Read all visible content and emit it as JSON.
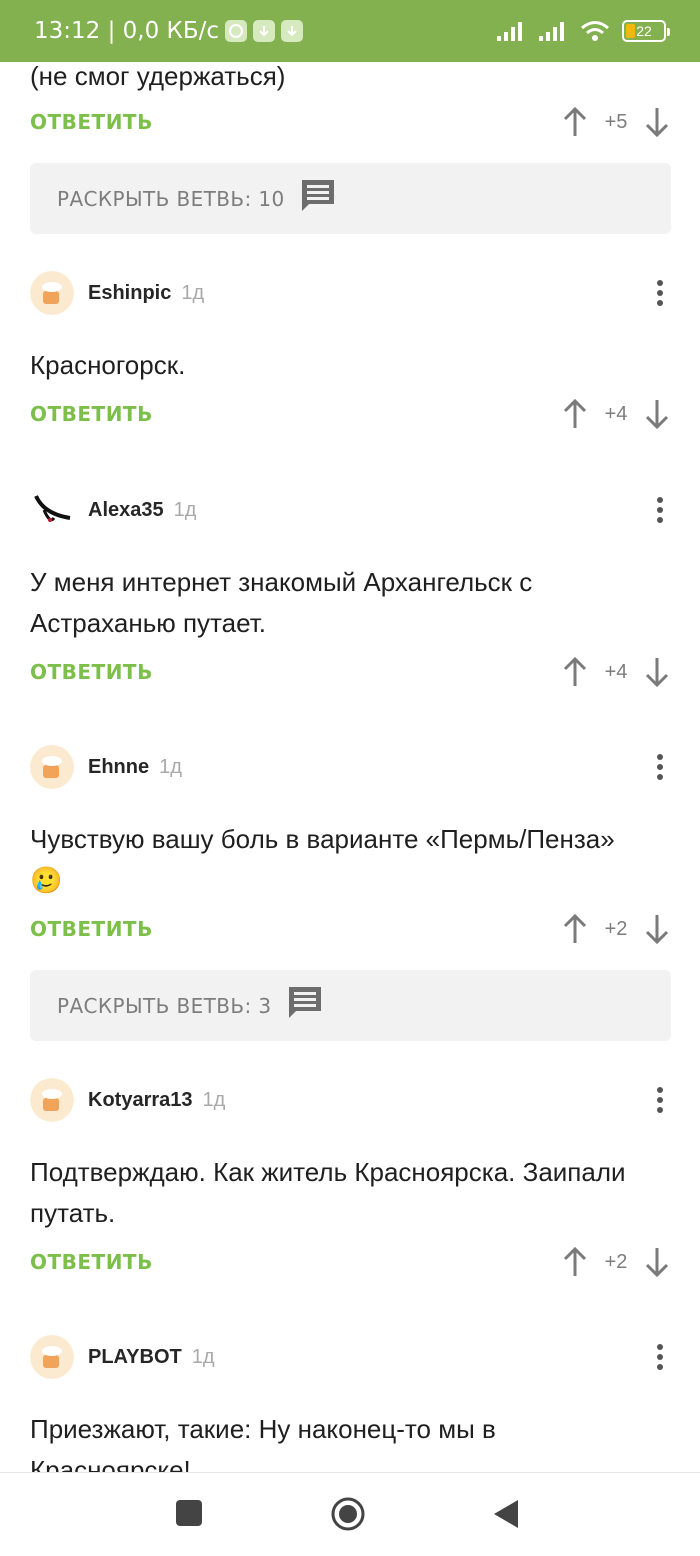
{
  "status_bar": {
    "time_speed": "13:12 | 0,0 КБ/с",
    "battery": "22",
    "accent_color": "#83b14f"
  },
  "top_partial": {
    "text": "(не смог удержаться)",
    "reply_label": "ОТВЕТИТЬ",
    "score": "+5"
  },
  "branches": [
    {
      "label": "РАСКРЫТЬ ВЕТВЬ: 10"
    },
    {
      "label": "РАСКРЫТЬ ВЕТВЬ: 3"
    }
  ],
  "comments": [
    {
      "author": "Eshinpic",
      "time": "1д",
      "text": "Красногорск.",
      "reply_label": "ОТВЕТИТЬ",
      "score": "+4"
    },
    {
      "author": "Alexa35",
      "time": "1д",
      "text": "У меня интернет знакомый Архангельск с Астраханью путает.",
      "reply_label": "ОТВЕТИТЬ",
      "score": "+4"
    },
    {
      "author": "Ehnne",
      "time": "1д",
      "text": "Чувствую вашу боль в варианте «Пермь/Пенза» 🥲",
      "reply_label": "ОТВЕТИТЬ",
      "score": "+2"
    },
    {
      "author": "Kotyarra13",
      "time": "1д",
      "text": "Подтверждаю. Как житель Красноярска. Заипали путать.",
      "reply_label": "ОТВЕТИТЬ",
      "score": "+2"
    },
    {
      "author": "PLAYBOT",
      "time": "1д",
      "text": "Приезжают, такие: Ну наконец-то мы в Красноярске!"
    }
  ],
  "icons": {
    "upvote": "arrow-up-icon",
    "downvote": "arrow-down-icon",
    "branch": "comment-icon",
    "more": "more-vertical-icon"
  }
}
